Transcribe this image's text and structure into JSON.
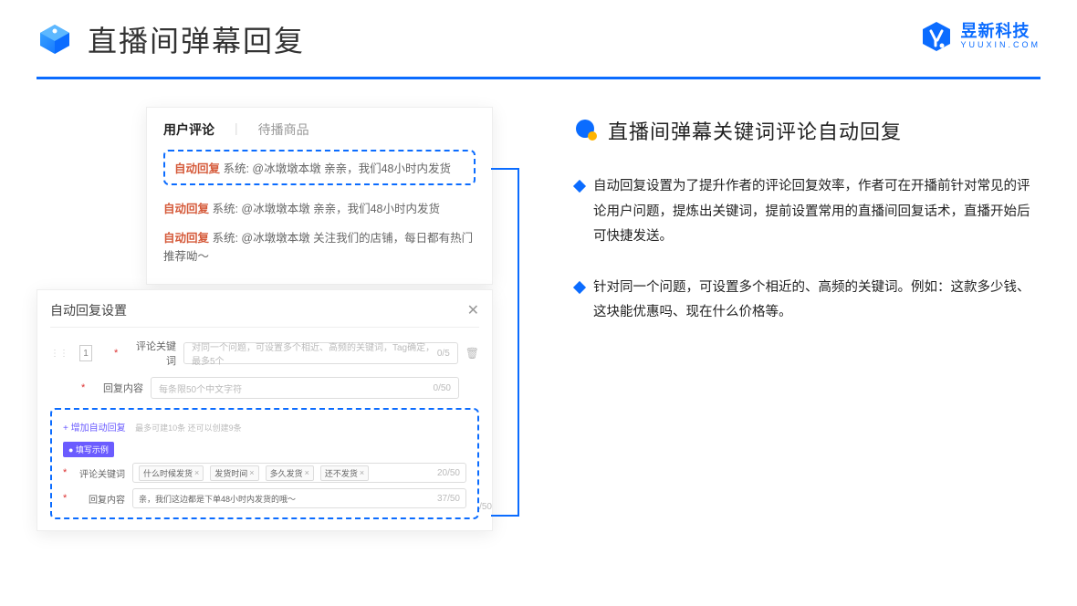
{
  "header": {
    "title": "直播间弹幕回复"
  },
  "brand": {
    "cn": "昱新科技",
    "en": "YUUXIN.COM"
  },
  "card1": {
    "tab_active": "用户评论",
    "tab_inactive": "待播商品",
    "highlight_prefix": "自动回复",
    "highlight_rest": " 系统: @冰墩墩本墩 亲亲，我们48小时内发货",
    "line2_prefix": "自动回复",
    "line2_rest": " 系统: @冰墩墩本墩 亲亲，我们48小时内发货",
    "line3_prefix": "自动回复",
    "line3_rest": " 系统: @冰墩墩本墩 关注我们的店铺，每日都有热门推荐呦～"
  },
  "card2": {
    "title": "自动回复设置",
    "num": "1",
    "label_keyword": "评论关键词",
    "placeholder_keyword": "对同一个问题，可设置多个相近、高频的关键词，Tag确定，最多5个",
    "count_keyword": "0/5",
    "label_content": "回复内容",
    "placeholder_content": "每条限50个中文字符",
    "count_content": "0/50",
    "add_link": "+ 增加自动回复",
    "add_hint": "最多可建10条 还可以创建9条",
    "badge": "● 填写示例",
    "ex_label_keyword": "评论关键词",
    "chips": [
      "什么时候发货",
      "发货时间",
      "多久发货",
      "还不发货"
    ],
    "chip_count": "20/50",
    "ex_label_content": "回复内容",
    "ex_content": "亲，我们这边都是下单48小时内发货的哦～",
    "ex_count": "37/50",
    "outer_count": "/50"
  },
  "right": {
    "section_title": "直播间弹幕关键词评论自动回复",
    "bullet1": "自动回复设置为了提升作者的评论回复效率，作者可在开播前针对常见的评论用户问题，提炼出关键词，提前设置常用的直播间回复话术，直播开始后可快捷发送。",
    "bullet2": "针对同一个问题，可设置多个相近的、高频的关键词。例如：这款多少钱、这块能优惠吗、现在什么价格等。"
  }
}
